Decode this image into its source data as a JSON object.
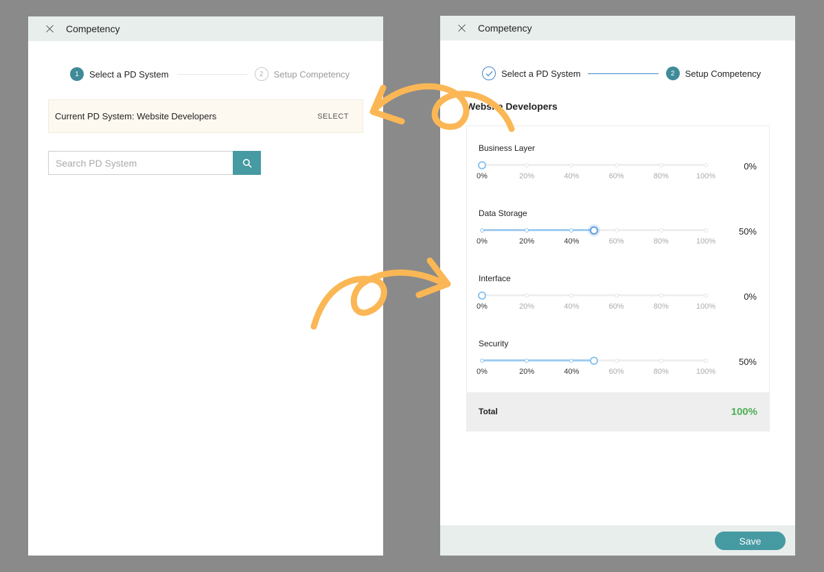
{
  "left": {
    "header": {
      "title": "Competency"
    },
    "steps": [
      {
        "number": "1",
        "label": "Select a PD System",
        "state": "active"
      },
      {
        "number": "2",
        "label": "Setup Competency",
        "state": "inactive"
      }
    ],
    "current_system": {
      "text": "Current PD System: Website Developers",
      "select_label": "SELECT"
    },
    "search": {
      "placeholder": "Search PD System",
      "value": "",
      "icon": "search-icon"
    }
  },
  "right": {
    "header": {
      "title": "Competency"
    },
    "steps": [
      {
        "number": "",
        "label": "Select a PD System",
        "state": "done",
        "icon": "check-icon"
      },
      {
        "number": "2",
        "label": "Setup Competency",
        "state": "active"
      }
    ],
    "section_title": "Website Developers",
    "ticks": [
      "0%",
      "20%",
      "40%",
      "60%",
      "80%",
      "100%"
    ],
    "competencies": [
      {
        "label": "Business Layer",
        "percent": 0,
        "value_text": "0%"
      },
      {
        "label": "Data Storage",
        "percent": 50,
        "value_text": "50%",
        "focused": true
      },
      {
        "label": "Interface",
        "percent": 0,
        "value_text": "0%"
      },
      {
        "label": "Security",
        "percent": 50,
        "value_text": "50%"
      }
    ],
    "total": {
      "label": "Total",
      "value": "100%"
    },
    "footer": {
      "save_label": "Save"
    }
  },
  "colors": {
    "accent_teal": "#469aa2",
    "step_active": "#3f8b98",
    "slider_track": "#9fcdf1",
    "total_green": "#4caf50",
    "annotation_arrow": "#fbb755",
    "header_bg": "#e8eeec"
  }
}
